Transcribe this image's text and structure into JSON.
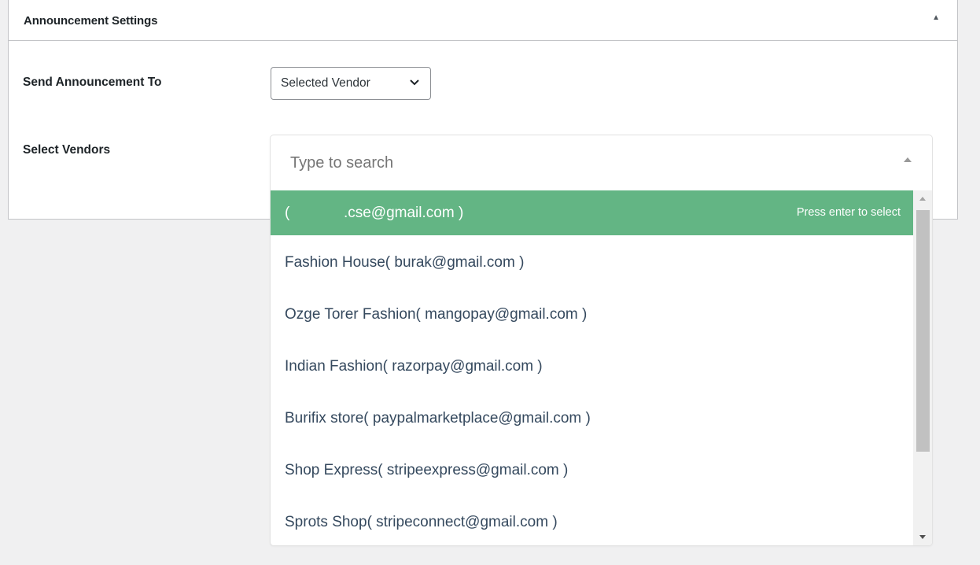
{
  "panel": {
    "title": "Announcement Settings"
  },
  "send_to": {
    "label": "Send Announcement To",
    "selected_value": "Selected Vendor"
  },
  "select_vendors": {
    "label": "Select Vendors",
    "search_placeholder": "Type to search",
    "hint": "Press enter to select",
    "options": [
      {
        "label": "(             .cse@gmail.com )"
      },
      {
        "label": "Fashion House( burak@gmail.com )"
      },
      {
        "label": "Ozge Torer Fashion( mangopay@gmail.com )"
      },
      {
        "label": "Indian Fashion( razorpay@gmail.com )"
      },
      {
        "label": "Burifix store( paypalmarketplace@gmail.com )"
      },
      {
        "label": "Shop Express( stripeexpress@gmail.com )"
      },
      {
        "label": "Sprots Shop( stripeconnect@gmail.com )"
      }
    ],
    "highlight_color": "#63b584"
  },
  "icons": {
    "panel_toggle": "triangle-up-icon",
    "select_chevron": "chevron-down-icon",
    "dropdown_caret": "caret-up-icon"
  }
}
